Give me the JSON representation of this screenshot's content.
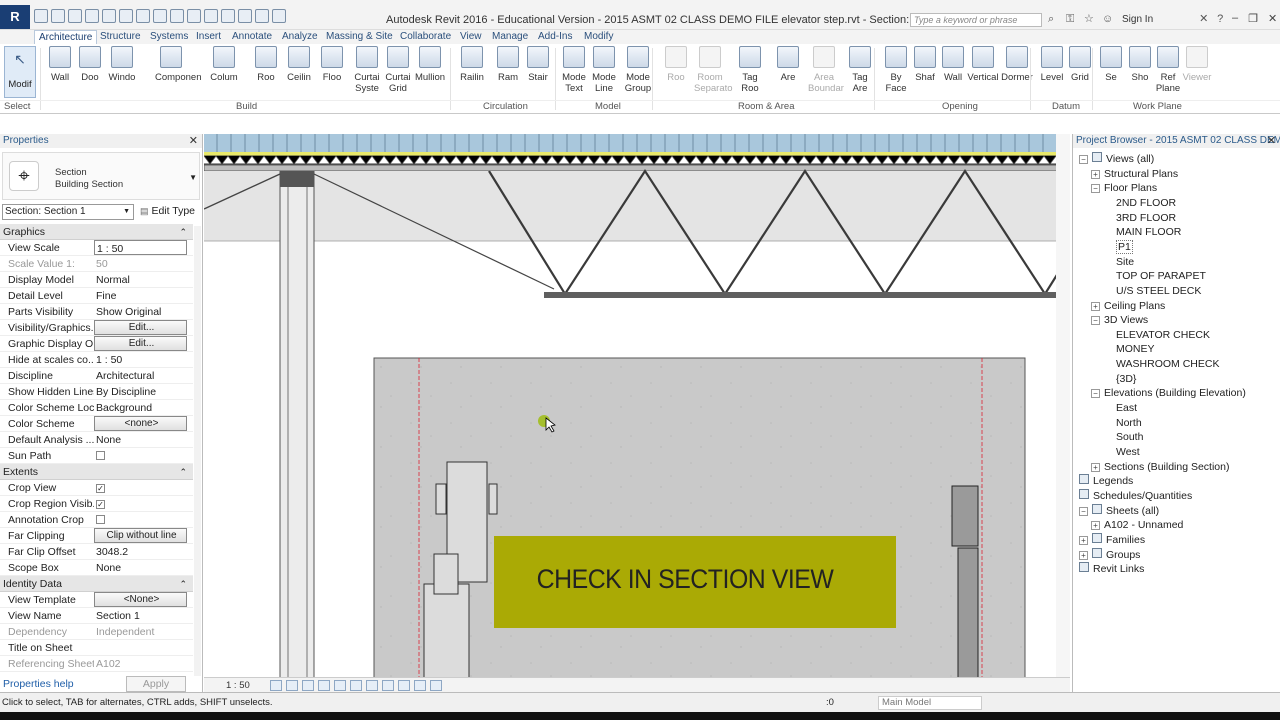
{
  "app": {
    "logo_letter": "R",
    "title": "Autodesk Revit 2016 - Educational Version -    2015 ASMT 02 CLASS DEMO FILE elevator step.rvt - Section: Section 1",
    "search_placeholder": "Type a keyword or phrase",
    "sign_in": "Sign In"
  },
  "tabs": [
    "Architecture",
    "Structure",
    "Systems",
    "Insert",
    "Annotate",
    "Analyze",
    "Massing & Site",
    "Collaborate",
    "View",
    "Manage",
    "Add-Ins",
    "Modify"
  ],
  "active_tab": "Architecture",
  "ribbon": {
    "select": {
      "label": "Modif",
      "panel": "Select"
    },
    "build": [
      "Wall",
      "Doo",
      "Windo",
      "Componen",
      "Colum",
      "Roo",
      "Ceilin",
      "Floo",
      "Curtai Syste",
      "Curtai Grid",
      "Mullion"
    ],
    "build_panel": "Build",
    "circulation": [
      "Railin",
      "Ram",
      "Stair"
    ],
    "circulation_panel": "Circulation",
    "model": [
      "Mode Text",
      "Mode Line",
      "Mode Group"
    ],
    "model_panel": "Model",
    "room_area": [
      "Roo",
      "Room Separato",
      "Tag Roo",
      "Are",
      "Area Boundar",
      "Tag Are"
    ],
    "room_area_panel": "Room & Area",
    "opening": [
      "By Face",
      "Shaf",
      "Wall",
      "Vertical",
      "Dormer"
    ],
    "opening_panel": "Opening",
    "datum": [
      "Level",
      "Grid"
    ],
    "datum_panel": "Datum",
    "work_plane": [
      "Se",
      "Sho",
      "Ref Plane",
      "Viewer"
    ],
    "work_plane_panel": "Work Plane"
  },
  "properties": {
    "title": "Properties",
    "type_name": "Section",
    "type_sub": "Building Section",
    "instance": "Section: Section 1",
    "edit_type": "Edit Type",
    "categories": [
      {
        "name": "Graphics",
        "rows": [
          {
            "k": "View Scale",
            "v": "1 : 50",
            "style": "box"
          },
          {
            "k": "Scale Value    1:",
            "v": "50",
            "style": "grey"
          },
          {
            "k": "Display Model",
            "v": "Normal"
          },
          {
            "k": "Detail Level",
            "v": "Fine"
          },
          {
            "k": "Parts Visibility",
            "v": "Show Original"
          },
          {
            "k": "Visibility/Graphics...",
            "v": "Edit...",
            "style": "btn"
          },
          {
            "k": "Graphic Display O...",
            "v": "Edit...",
            "style": "btn"
          },
          {
            "k": "Hide at scales co...",
            "v": "1 : 50"
          },
          {
            "k": "Discipline",
            "v": "Architectural"
          },
          {
            "k": "Show Hidden Lines",
            "v": "By Discipline"
          },
          {
            "k": "Color Scheme Loc...",
            "v": "Background"
          },
          {
            "k": "Color Scheme",
            "v": "<none>",
            "style": "btn"
          },
          {
            "k": "Default Analysis ...",
            "v": "None"
          },
          {
            "k": "Sun Path",
            "v": "",
            "check": false
          }
        ]
      },
      {
        "name": "Extents",
        "rows": [
          {
            "k": "Crop View",
            "v": "",
            "check": true
          },
          {
            "k": "Crop Region Visib...",
            "v": "",
            "check": true
          },
          {
            "k": "Annotation Crop",
            "v": "",
            "check": false
          },
          {
            "k": "Far Clipping",
            "v": "Clip without line",
            "style": "btn"
          },
          {
            "k": "Far Clip Offset",
            "v": "3048.2"
          },
          {
            "k": "Scope Box",
            "v": "None"
          }
        ]
      },
      {
        "name": "Identity Data",
        "rows": [
          {
            "k": "View Template",
            "v": "<None>",
            "style": "btn"
          },
          {
            "k": "View Name",
            "v": "Section 1"
          },
          {
            "k": "Dependency",
            "v": "Independent",
            "style": "grey"
          },
          {
            "k": "Title on Sheet",
            "v": ""
          },
          {
            "k": "Referencing Sheet",
            "v": "A102",
            "style": "grey"
          }
        ]
      }
    ],
    "help": "Properties help",
    "apply": "Apply"
  },
  "canvas": {
    "banner": "CHECK IN SECTION VIEW",
    "scale": "1 : 50"
  },
  "browser": {
    "title": "Project Browser - 2015 ASMT 02 CLASS DEMO ...",
    "nodes": [
      {
        "t": "Views (all)",
        "lvl": 0,
        "toggle": "−",
        "icon": true
      },
      {
        "t": "Structural Plans",
        "lvl": 1,
        "toggle": "+"
      },
      {
        "t": "Floor Plans",
        "lvl": 1,
        "toggle": "−"
      },
      {
        "t": "2ND FLOOR",
        "lvl": 2
      },
      {
        "t": "3RD FLOOR",
        "lvl": 2
      },
      {
        "t": "MAIN FLOOR",
        "lvl": 2
      },
      {
        "t": "P1",
        "lvl": 2,
        "sel": true
      },
      {
        "t": "Site",
        "lvl": 2
      },
      {
        "t": "TOP OF PARAPET",
        "lvl": 2
      },
      {
        "t": "U/S STEEL DECK",
        "lvl": 2
      },
      {
        "t": "Ceiling Plans",
        "lvl": 1,
        "toggle": "+"
      },
      {
        "t": "3D Views",
        "lvl": 1,
        "toggle": "−"
      },
      {
        "t": "ELEVATOR CHECK",
        "lvl": 2
      },
      {
        "t": "MONEY",
        "lvl": 2
      },
      {
        "t": "WASHROOM CHECK",
        "lvl": 2
      },
      {
        "t": "{3D}",
        "lvl": 2
      },
      {
        "t": "Elevations (Building Elevation)",
        "lvl": 1,
        "toggle": "−"
      },
      {
        "t": "East",
        "lvl": 2
      },
      {
        "t": "North",
        "lvl": 2
      },
      {
        "t": "South",
        "lvl": 2
      },
      {
        "t": "West",
        "lvl": 2
      },
      {
        "t": "Sections (Building Section)",
        "lvl": 1,
        "toggle": "+"
      },
      {
        "t": "Legends",
        "lvl": 0,
        "icon": true
      },
      {
        "t": "Schedules/Quantities",
        "lvl": 0,
        "icon": true
      },
      {
        "t": "Sheets (all)",
        "lvl": 0,
        "toggle": "−",
        "icon": true
      },
      {
        "t": "A102 - Unnamed",
        "lvl": 1,
        "toggle": "+"
      },
      {
        "t": "Families",
        "lvl": 0,
        "toggle": "+",
        "icon": true
      },
      {
        "t": "Groups",
        "lvl": 0,
        "toggle": "+",
        "icon": true
      },
      {
        "t": "Revit Links",
        "lvl": 0,
        "icon": true
      }
    ]
  },
  "status": {
    "text": "Click to select, TAB for alternates, CTRL adds, SHIFT unselects.",
    "zero": ":0",
    "model": "Main Model"
  },
  "colors": {
    "accent": "#1a3e74",
    "banner": "#aaaa05",
    "cursor_marker": "#9fbd12"
  }
}
